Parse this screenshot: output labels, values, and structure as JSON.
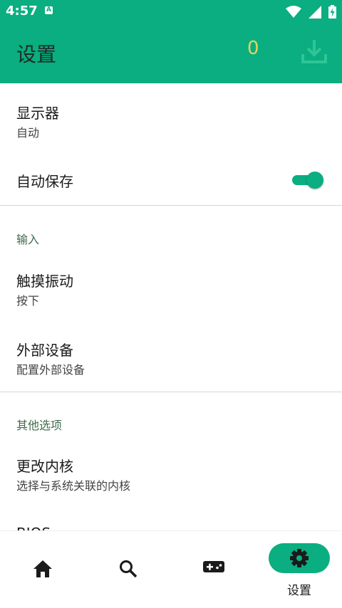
{
  "status_bar": {
    "time": "4:57",
    "notification_letter": "A"
  },
  "app_bar": {
    "title": "设置",
    "counter": "0"
  },
  "settings": {
    "display": {
      "title": "显示器",
      "value": "自动"
    },
    "autosave": {
      "title": "自动保存",
      "enabled": true
    },
    "input_section": {
      "header": "输入"
    },
    "haptic": {
      "title": "触摸振动",
      "value": "按下"
    },
    "external_devices": {
      "title": "外部设备",
      "value": "配置外部设备"
    },
    "other_section": {
      "header": "其他选项"
    },
    "change_core": {
      "title": "更改内核",
      "value": "选择与系统关联的内核"
    },
    "bios": {
      "title": "BIOS"
    }
  },
  "bottom_nav": {
    "items": [
      {
        "icon": "home-icon"
      },
      {
        "icon": "search-icon"
      },
      {
        "icon": "gamepad-icon"
      },
      {
        "icon": "gear-icon",
        "label": "设置",
        "selected": true
      }
    ]
  },
  "colors": {
    "accent": "#0aae80",
    "counter": "#e3d45a",
    "section_header": "#3f6b4a"
  }
}
